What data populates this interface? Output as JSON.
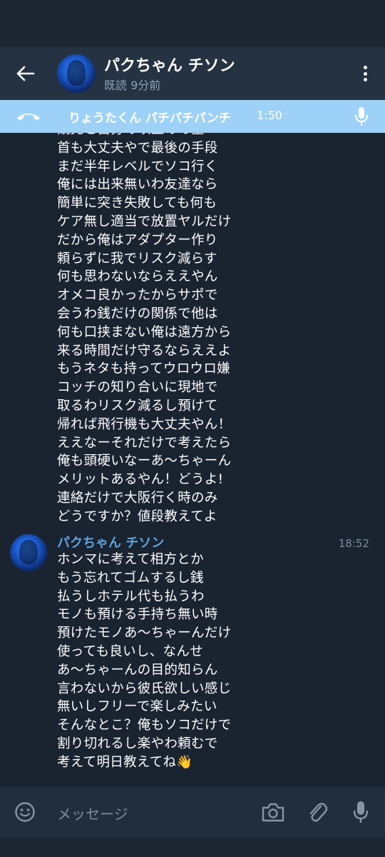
{
  "header": {
    "title": "パクちゃん チソン",
    "status": "既読 9分前"
  },
  "player": {
    "title": "りょうたくん パチパチパンチ",
    "time": "1:50"
  },
  "messages": [
    {
      "text": "競売と自分の以上のの全\n首も大丈夫やで最後の手段\nまだ半年レベルでソコ行く\n俺には出来無いわ友達なら\n簡単に突き失敗しても何も\nケア無し適当で放置ヤルだけ\nだから俺はアダプター作り\n頼らずに我でリスク減らす\n何も思わないならええやん\nオメコ良かったからサポで\n会うわ銭だけの関係で他は\n何も口挟まない俺は遠方から\n来る時間だけ守るならええよ\nもうネタも持ってウロウロ嫌\nコッチの知り合いに現地で\n取るわリスク減るし預けて\n帰れば飛行機も大丈夫やん！\nええなーそれだけで考えたら\n俺も頭硬いなーあ〜ちゃーん\nメリットあるやん！どうよ!\n連絡だけで大阪行く時のみ\nどうですか？値段教えてよ"
    },
    {
      "sender": "パクちゃん チソン",
      "time": "18:52",
      "text": "ホンマに考えて相方とか\nもう忘れてゴムするし銭\n払うしホテル代も払うわ\nモノも預ける手持ち無い時\n預けたモノあ〜ちゃーんだけ\n使っても良いし、なんせ\nあ〜ちゃーんの目的知らん\n言わないから彼氏欲しい感じ\n無いしフリーで楽しみたい\nそんなとこ？俺もソコだけで\n割り切れるし楽やわ頼むで\n考えて明日教えてね👋"
    }
  ],
  "composer": {
    "placeholder": "メッセージ"
  },
  "colors": {
    "background": "#1a2330",
    "header": "#253242",
    "player_bar": "#9ed1f7",
    "sender_name": "#5ea5e0"
  }
}
